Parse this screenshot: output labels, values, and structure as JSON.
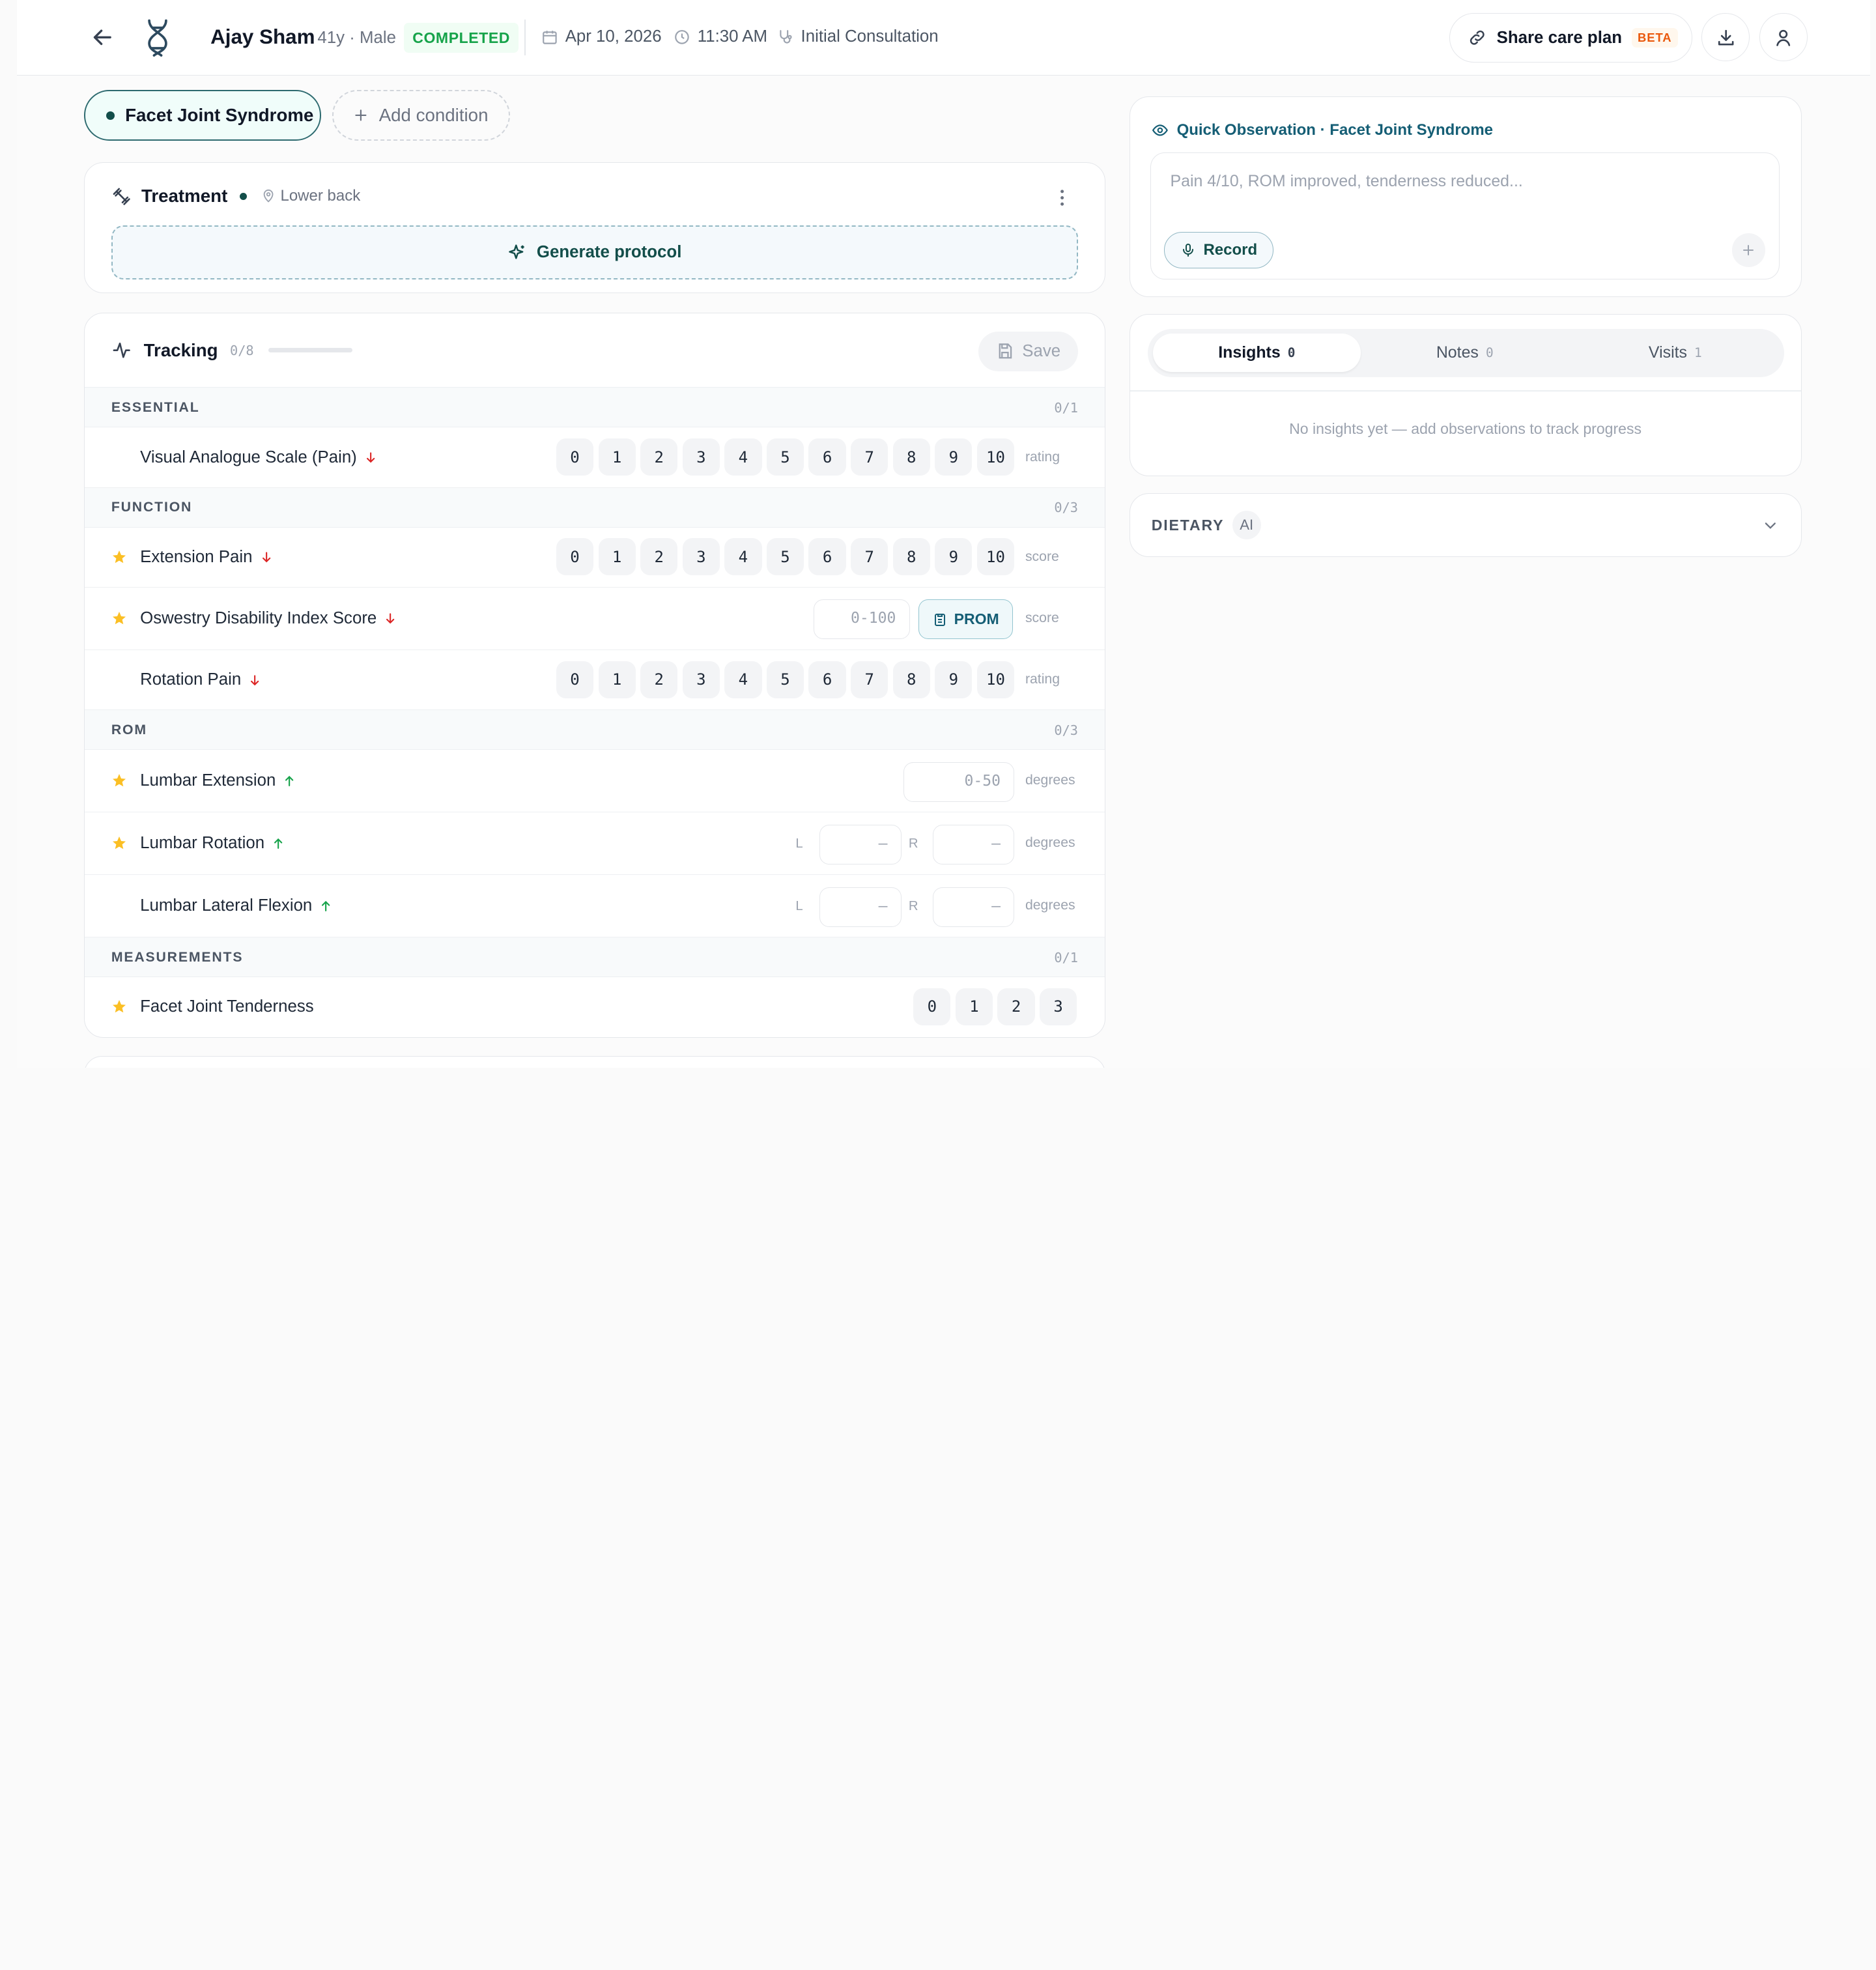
{
  "header": {
    "patient_name": "Ajay Sham",
    "patient_meta": "41y · Male",
    "status": "COMPLETED",
    "date": "Apr 10, 2026",
    "time": "11:30 AM",
    "visit_type": "Initial Consultation",
    "share_label": "Share care plan",
    "share_badge": "BETA"
  },
  "conditions": {
    "active": "Facet Joint Syndrome",
    "add_label": "Add condition"
  },
  "treatment": {
    "title": "Treatment",
    "location": "Lower back",
    "generate_label": "Generate protocol"
  },
  "tracking": {
    "title": "Tracking",
    "count": "0/8",
    "progress": 0,
    "save_label": "Save",
    "scale_0_10": [
      "0",
      "1",
      "2",
      "3",
      "4",
      "5",
      "6",
      "7",
      "8",
      "9",
      "10"
    ],
    "scale_0_3": [
      "0",
      "1",
      "2",
      "3"
    ],
    "sections": {
      "essential": {
        "name": "ESSENTIAL",
        "count": "0/1"
      },
      "function": {
        "name": "FUNCTION",
        "count": "0/3"
      },
      "rom": {
        "name": "ROM",
        "count": "0/3"
      },
      "measurements": {
        "name": "MEASUREMENTS",
        "count": "0/1"
      }
    },
    "rows": {
      "vas": {
        "label": "Visual Analogue Scale (Pain)",
        "unit": "rating",
        "starred": false,
        "direction": "down"
      },
      "extension_pain": {
        "label": "Extension Pain",
        "unit": "score",
        "starred": true,
        "direction": "down"
      },
      "odi": {
        "label": "Oswestry Disability Index Score",
        "placeholder": "0-100",
        "prom_label": "PROM",
        "unit": "score",
        "starred": true,
        "direction": "down"
      },
      "rotation_pain": {
        "label": "Rotation Pain",
        "unit": "rating",
        "starred": false,
        "direction": "down"
      },
      "lumbar_extension": {
        "label": "Lumbar Extension",
        "placeholder": "0-50",
        "unit": "degrees",
        "starred": true,
        "direction": "up"
      },
      "lumbar_rotation": {
        "label": "Lumbar Rotation",
        "left": "L",
        "right": "R",
        "placeholder": "–",
        "unit": "degrees",
        "starred": true,
        "direction": "up"
      },
      "lumbar_lateral_flexion": {
        "label": "Lumbar Lateral Flexion",
        "left": "L",
        "right": "R",
        "placeholder": "–",
        "unit": "degrees",
        "starred": false,
        "direction": "up"
      },
      "facet_tenderness": {
        "label": "Facet Joint Tenderness",
        "starred": true
      }
    }
  },
  "observation": {
    "title": "Quick Observation · Facet Joint Syndrome",
    "placeholder": "Pain 4/10, ROM improved, tenderness reduced...",
    "record_label": "Record"
  },
  "insights": {
    "tabs": [
      {
        "label": "Insights",
        "count": "0"
      },
      {
        "label": "Notes",
        "count": "0"
      },
      {
        "label": "Visits",
        "count": "1"
      }
    ],
    "empty_text": "No insights yet — add observations to track progress"
  },
  "dietary": {
    "label": "DIETARY",
    "badge": "AI"
  },
  "colors": {
    "accent": "#134e4a",
    "status_green": "#16a34a",
    "star": "#fbbf24",
    "arrow_down": "#dc2626",
    "arrow_up": "#16a34a"
  }
}
